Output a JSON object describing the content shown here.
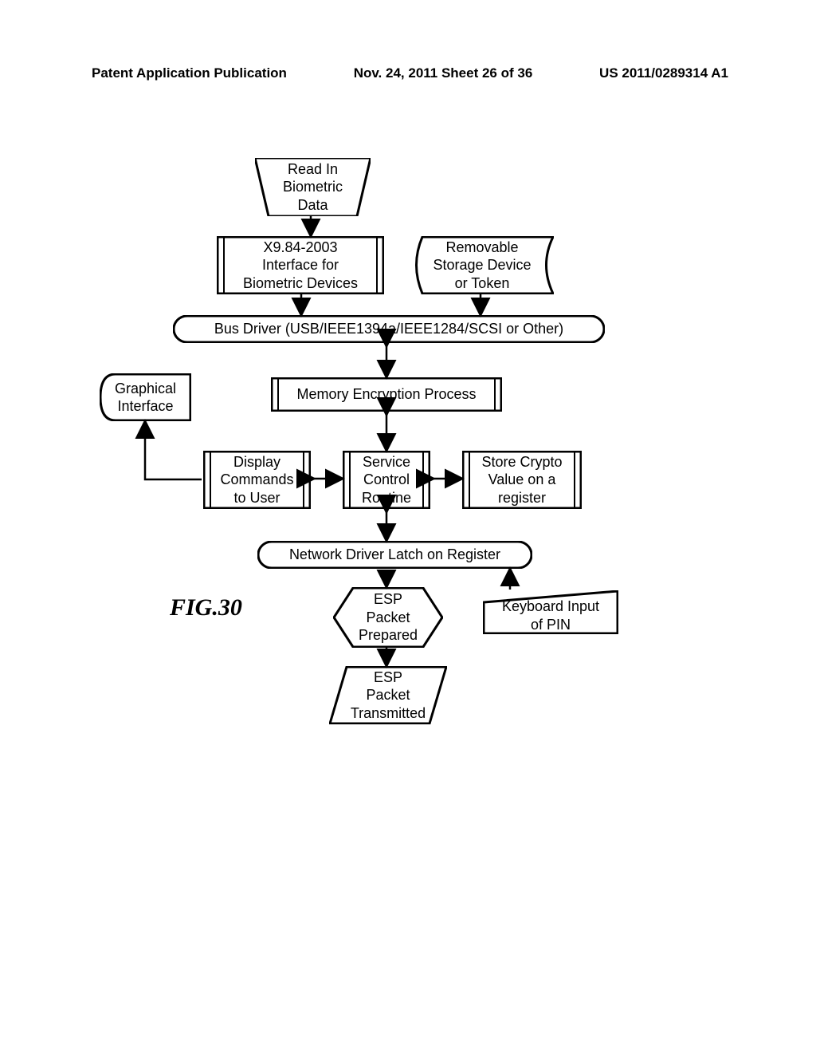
{
  "header": {
    "left": "Patent Application Publication",
    "center": "Nov. 24, 2011  Sheet 26 of 36",
    "right": "US 2011/0289314 A1"
  },
  "figLabel": "FIG.30",
  "nodes": {
    "readIn": "Read In\nBiometric\nData",
    "x984": "X9.84-2003\nInterface for\nBiometric Devices",
    "removable": "Removable\nStorage Device\nor Token",
    "busDriver": "Bus Driver (USB/IEEE1394a/IEEE1284/SCSI or Other)",
    "graphical": "Graphical\nInterface",
    "memEnc": "Memory Encryption Process",
    "display": "Display\nCommands\nto User",
    "service": "Service\nControl\nRoutine",
    "store": "Store Crypto\nValue on a\nregister",
    "netDriver": "Network Driver Latch on Register",
    "espPrep": "ESP\nPacket\nPrepared",
    "keyboard": "Keyboard Input\nof PIN",
    "espTrans": "ESP\nPacket\nTransmitted"
  }
}
